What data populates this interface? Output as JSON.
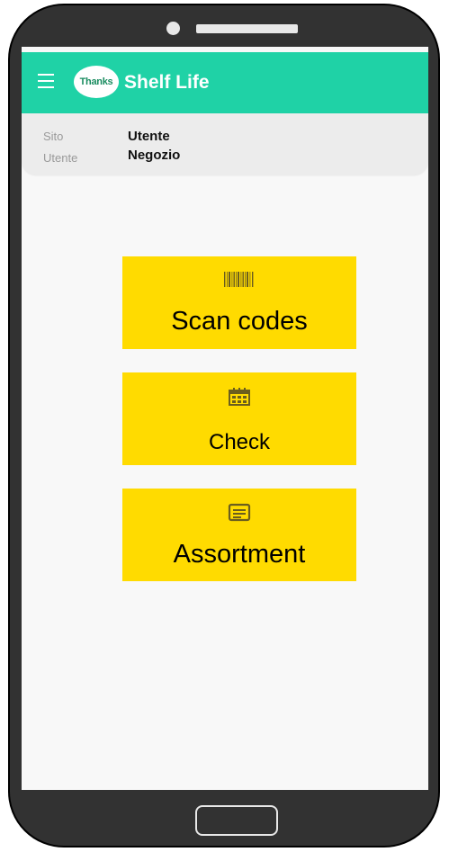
{
  "app": {
    "logo_text": "Thanks",
    "title": "Shelf Life",
    "accent_color": "#1fd2a6",
    "button_color": "#ffdb00"
  },
  "info": {
    "site_label": "Sito",
    "site_value": "Utente",
    "user_label": "Utente",
    "user_value": "Negozio"
  },
  "menu": {
    "scan": {
      "label": "Scan codes",
      "icon": "barcode-icon"
    },
    "check": {
      "label": "Check",
      "icon": "calendar-icon"
    },
    "assortment": {
      "label": "Assortment",
      "icon": "notes-icon"
    }
  }
}
